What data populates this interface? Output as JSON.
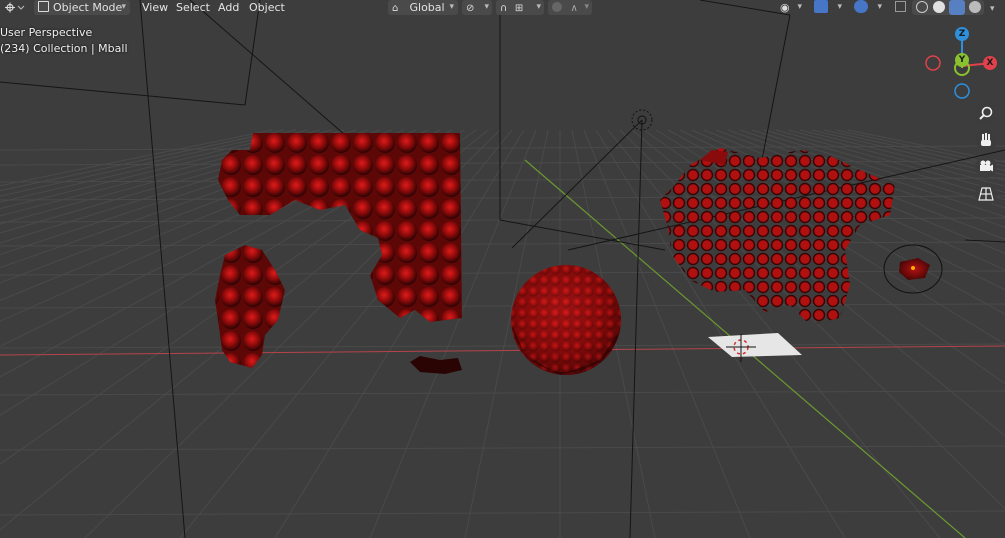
{
  "header": {
    "mode_label": "Object Mode",
    "menus": [
      "View",
      "Select",
      "Add",
      "Object"
    ],
    "orientation_label": "Global"
  },
  "overlay": {
    "view_name": "User Perspective",
    "collection_info": "(234) Collection | Mball"
  },
  "gizmo": {
    "x_label": "X",
    "y_label": "Y",
    "z_label": "Z",
    "x_color": "#e0414b",
    "y_color": "#8ac22f",
    "z_color": "#2e8fdc"
  },
  "icons": {
    "editor_type": "editor-type-icon",
    "object_mode": "object-mode-icon",
    "orientation": "orientation-icon",
    "pivot": "pivot-point-icon",
    "snap": "snap-magnet-icon",
    "snap_target": "snap-increment-icon",
    "proportional": "proportional-edit-icon",
    "falloff": "falloff-curve-icon",
    "visibility": "eye-icon",
    "gizmos": "gizmo-icon",
    "overlays": "overlay-icon",
    "xray": "xray-icon",
    "wireframe_shading": "wireframe-shading-icon",
    "solid_shading": "solid-shading-icon",
    "material_shading": "material-shading-icon",
    "rendered_shading": "rendered-shading-icon",
    "zoom": "zoom-icon",
    "pan": "hand-pan-icon",
    "camera": "camera-icon",
    "ortho": "grid-ortho-icon"
  },
  "colors": {
    "background": "#3d3d3d",
    "grid": "#4a4a4a",
    "x_axis": "#b5434a",
    "y_axis": "#6b9a2f",
    "metaball": "#c01010"
  }
}
